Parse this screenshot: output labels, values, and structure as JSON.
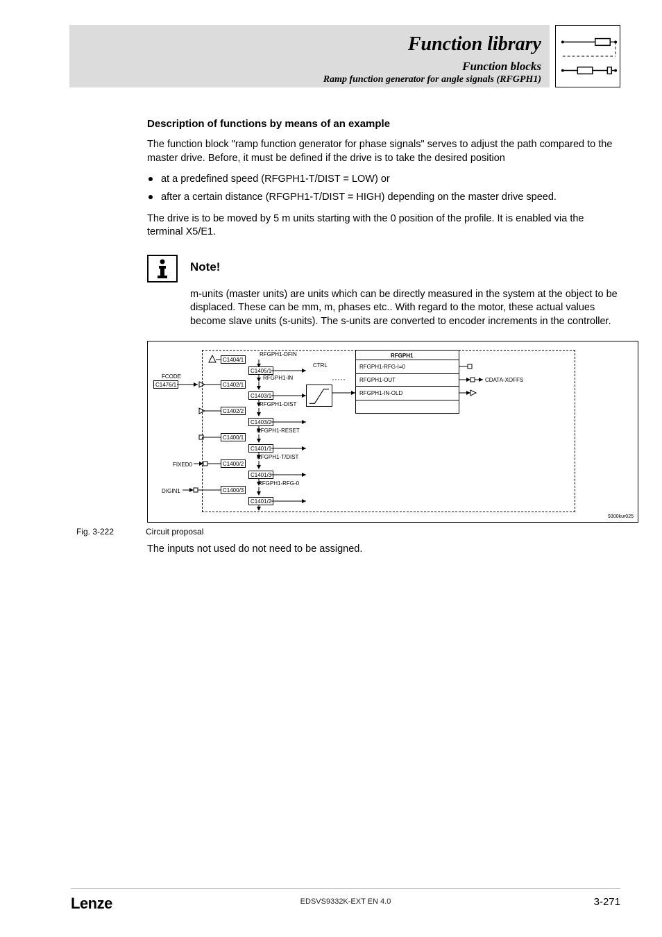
{
  "header": {
    "title": "Function library",
    "sub1": "Function blocks",
    "sub2": "Ramp function generator for angle signals (RFGPH1)"
  },
  "section": {
    "heading": "Description of functions by means of an example",
    "para1": "The function block \"ramp function generator for phase signals\" serves to adjust the path compared to the master drive. Before, it must be defined if the drive is to take the desired position",
    "bullets": [
      "at a predefined speed (RFGPH1-T/DIST = LOW) or",
      "after a certain distance (RFGPH1-T/DIST = HIGH) depending on the master drive speed."
    ],
    "para2": "The drive is to be moved by 5 m units starting with the 0 position of the profile. It is enabled via the terminal X5/E1."
  },
  "note": {
    "title": "Note!",
    "body": "m-units (master units) are units which can be directly measured in the system at the object to be displaced. These can be mm, m, phases etc.. With regard to the motor, these actual values become slave units (s-units). The s-units are converted to encoder increments in the controller."
  },
  "diagram": {
    "block_title": "RFGPH1",
    "ctrl_label": "CTRL",
    "left_labels": {
      "fcode": "FCODE",
      "fixed0": "FIXED0",
      "digin1": "DIGIN1"
    },
    "codes": {
      "c1476_1": "C1476/1",
      "c1404_1": "C1404/1",
      "c1405_1": "C1405/1",
      "c1402_1": "C1402/1",
      "c1403_1": "C1403/1",
      "c1402_2": "C1402/2",
      "c1403_2": "C1403/2",
      "c1400_1": "C1400/1",
      "c1401_1": "C1401/1",
      "c1400_2": "C1400/2",
      "c1401_3": "C1401/3",
      "c1400_3": "C1400/3",
      "c1401_2": "C1401/2"
    },
    "signals": {
      "dfin": "RFGPH1-DFIN",
      "in": "RFGPH1-IN",
      "dist": "RFGPH1-DIST",
      "reset": "RFGPH1-RESET",
      "tdist": "RFGPH1-T/DIST",
      "rfg0": "RFGPH1-RFG-0",
      "rfg_i0": "RFGPH1-RFG-I=0",
      "out": "RFGPH1-OUT",
      "in_old": "RFGPH1-IN-OLD",
      "cdata": "CDATA-XOFFS"
    },
    "code_ref": "9300kur025"
  },
  "figure": {
    "num": "Fig. 3-222",
    "caption": "Circuit proposal"
  },
  "after_fig": "The inputs not used do not need to be assigned.",
  "footer": {
    "brand": "Lenze",
    "mid": "EDSVS9332K-EXT EN 4.0",
    "page": "3-271"
  }
}
